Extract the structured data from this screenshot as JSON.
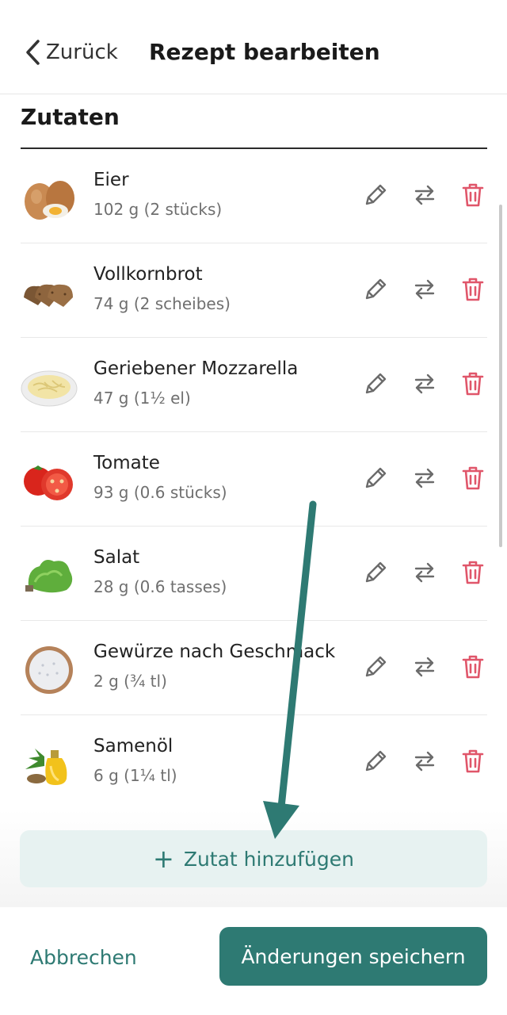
{
  "header": {
    "back_label": "Zurück",
    "title": "Rezept bearbeiten"
  },
  "section": {
    "title": "Zutaten"
  },
  "ingredients": [
    {
      "name": "Eier",
      "amount": "102 g (2 stücks)",
      "image": "eggs-image"
    },
    {
      "name": "Vollkornbrot",
      "amount": "74 g (2 scheibes)",
      "image": "bread-image"
    },
    {
      "name": "Geriebener Mozzarella",
      "amount": "47 g (1½ el)",
      "image": "mozzarella-image"
    },
    {
      "name": "Tomate",
      "amount": "93 g (0.6 stücks)",
      "image": "tomato-image"
    },
    {
      "name": "Salat",
      "amount": "28 g (0.6 tasses)",
      "image": "lettuce-image"
    },
    {
      "name": "Gewürze nach Geschmack",
      "amount": "2 g (¾ tl)",
      "image": "spices-image"
    },
    {
      "name": "Samenöl",
      "amount": "6 g (1¼ tl)",
      "image": "seed-oil-image"
    }
  ],
  "row_actions": {
    "edit_icon": "pencil-icon",
    "swap_icon": "swap-arrows-icon",
    "delete_icon": "trash-icon"
  },
  "add_button": {
    "plus": "+",
    "label": "Zutat hinzufügen"
  },
  "footer": {
    "cancel_label": "Abbrechen",
    "save_label": "Änderungen speichern"
  },
  "colors": {
    "accent": "#2e7a73",
    "accent_light": "#e7f2f1",
    "delete": "#e0566a",
    "icon_gray": "#6b6b6b",
    "annotation_arrow": "#2e7a73"
  }
}
